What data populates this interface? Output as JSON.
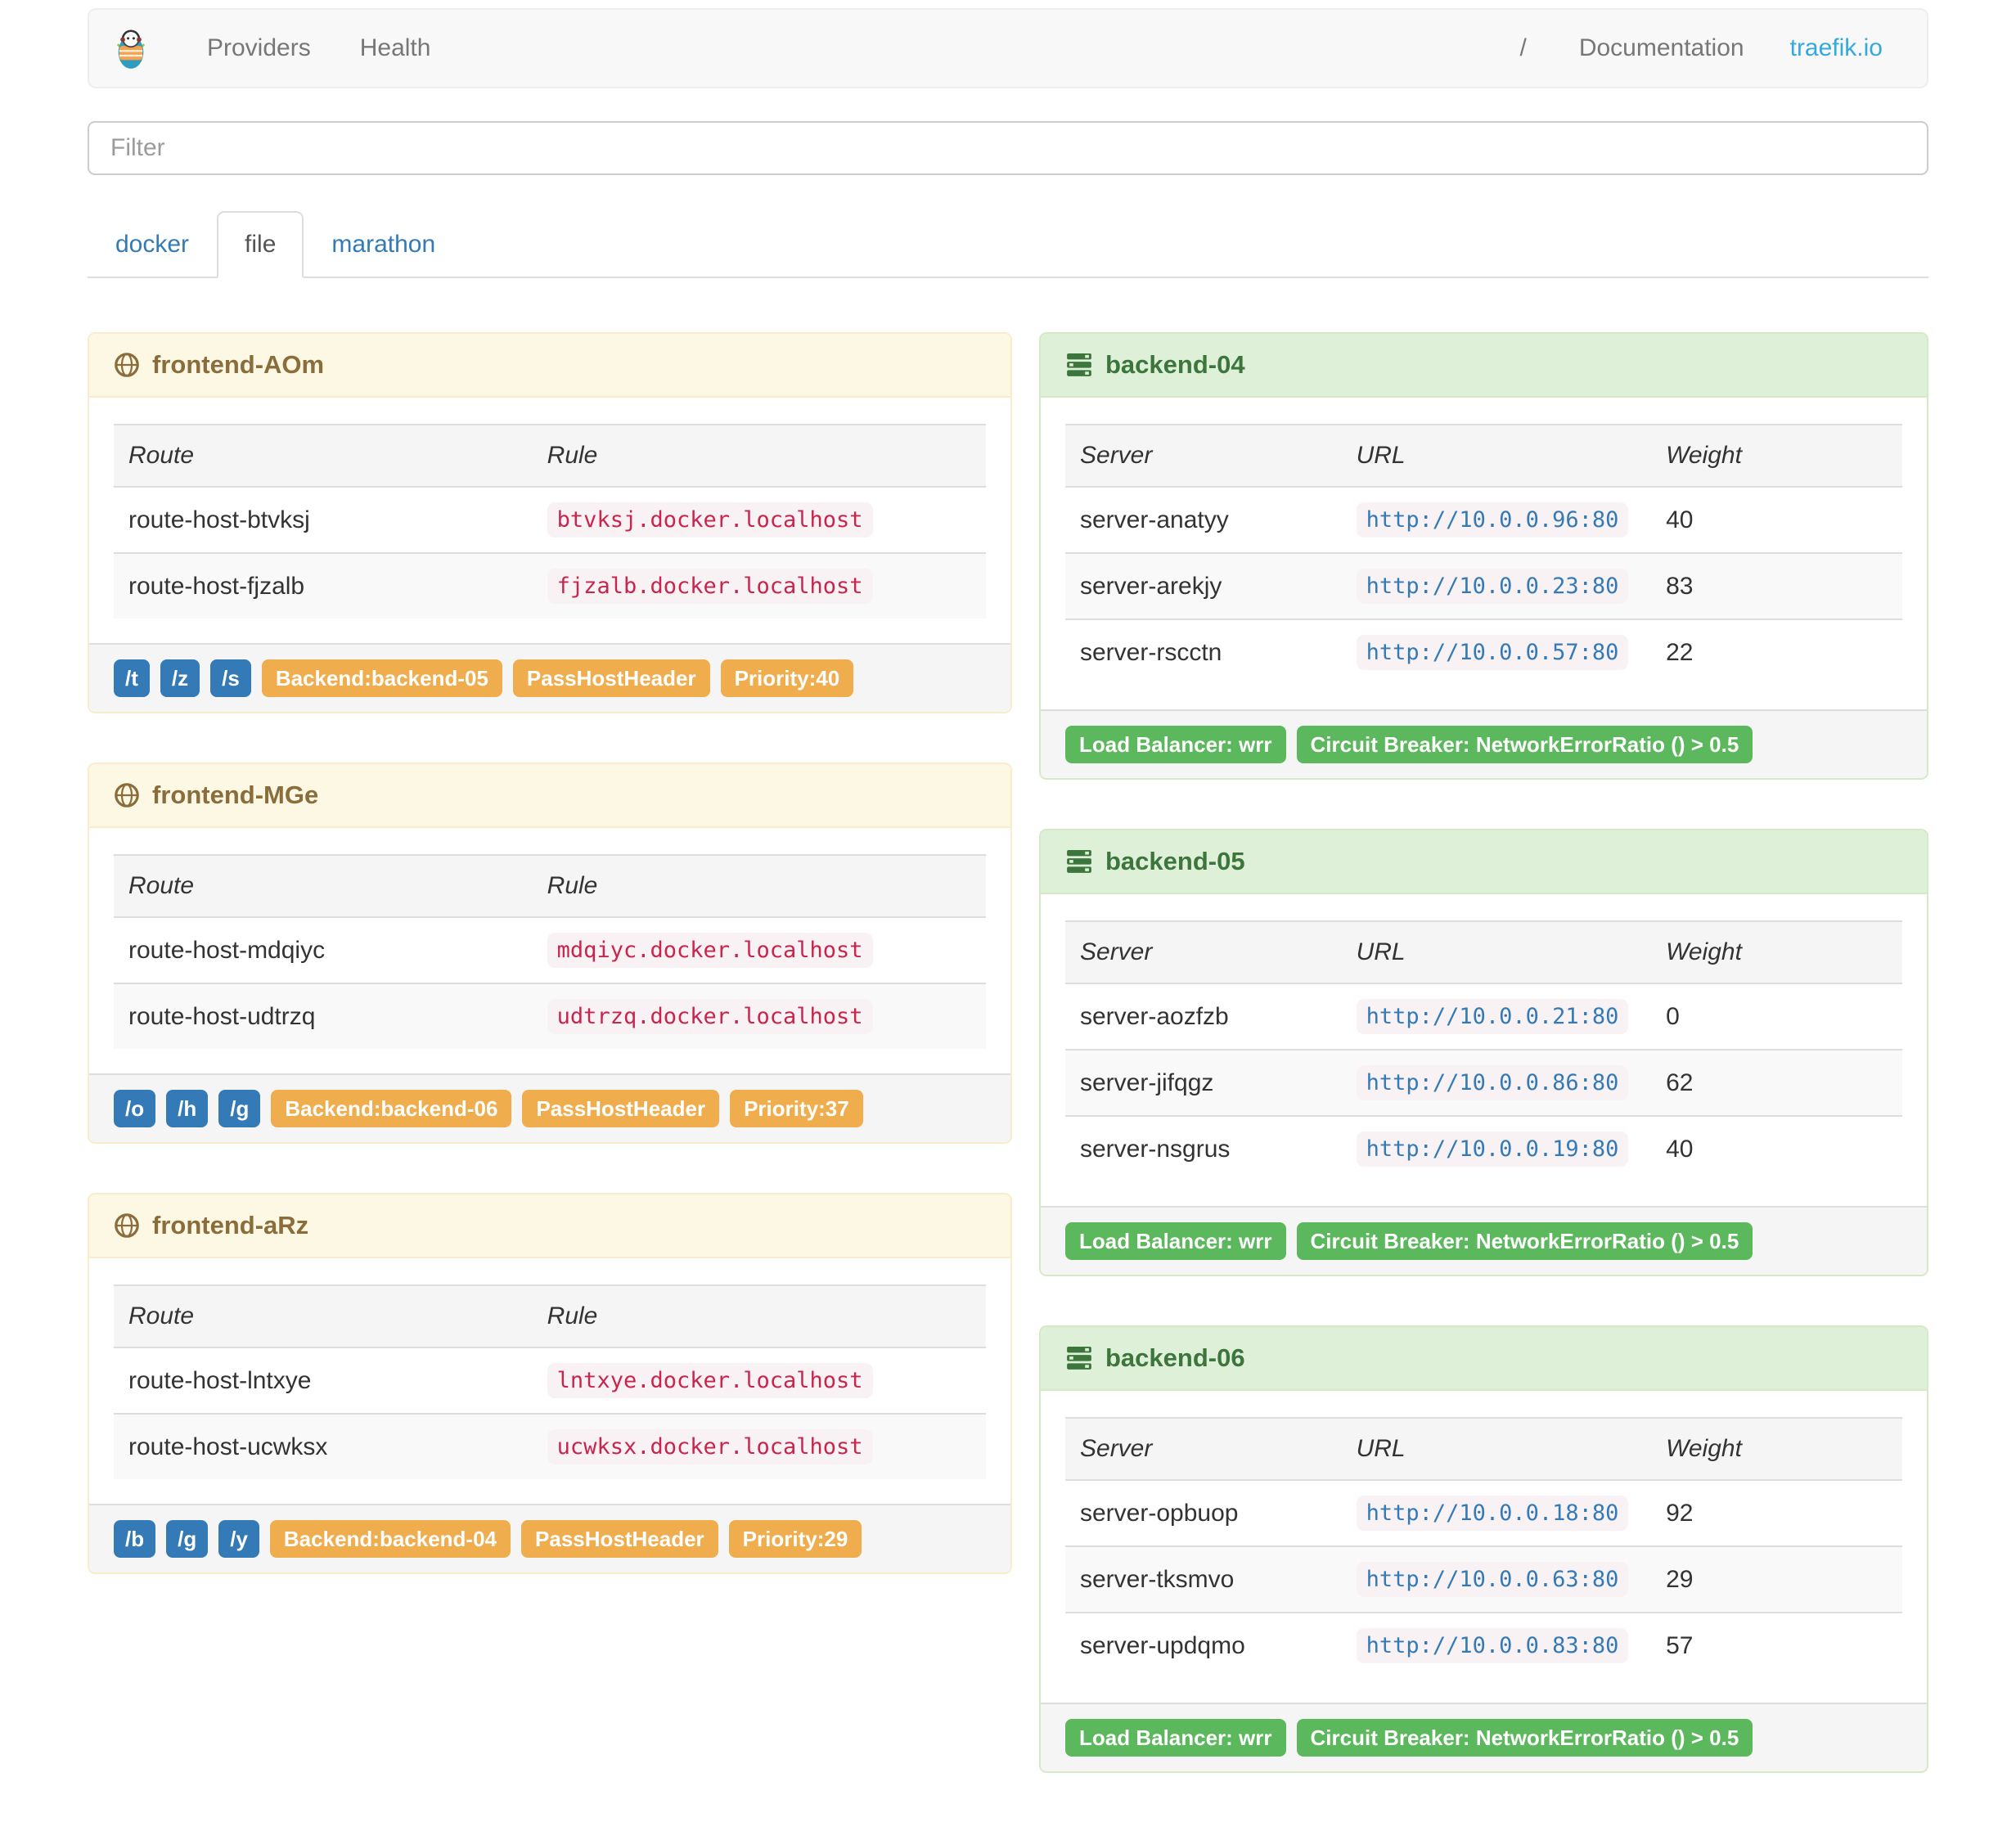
{
  "navbar": {
    "brand_icon": "traefik-logo",
    "links": [
      {
        "label": "Providers"
      },
      {
        "label": "Health"
      }
    ],
    "right": {
      "separator": "/",
      "documentation": "Documentation",
      "site": "traefik.io"
    }
  },
  "filter": {
    "placeholder": "Filter",
    "value": ""
  },
  "tabs": [
    {
      "label": "docker",
      "active": false
    },
    {
      "label": "file",
      "active": true
    },
    {
      "label": "marathon",
      "active": false
    }
  ],
  "frontends": [
    {
      "name": "frontend-AOm",
      "columns": [
        "Route",
        "Rule"
      ],
      "routes": [
        {
          "route": "route-host-btvksj",
          "rule": "btvksj.docker.localhost"
        },
        {
          "route": "route-host-fjzalb",
          "rule": "fjzalb.docker.localhost"
        }
      ],
      "entrypoints": [
        "/t",
        "/z",
        "/s"
      ],
      "badges": [
        "Backend:backend-05",
        "PassHostHeader",
        "Priority:40"
      ]
    },
    {
      "name": "frontend-MGe",
      "columns": [
        "Route",
        "Rule"
      ],
      "routes": [
        {
          "route": "route-host-mdqiyc",
          "rule": "mdqiyc.docker.localhost"
        },
        {
          "route": "route-host-udtrzq",
          "rule": "udtrzq.docker.localhost"
        }
      ],
      "entrypoints": [
        "/o",
        "/h",
        "/g"
      ],
      "badges": [
        "Backend:backend-06",
        "PassHostHeader",
        "Priority:37"
      ]
    },
    {
      "name": "frontend-aRz",
      "columns": [
        "Route",
        "Rule"
      ],
      "routes": [
        {
          "route": "route-host-lntxye",
          "rule": "lntxye.docker.localhost"
        },
        {
          "route": "route-host-ucwksx",
          "rule": "ucwksx.docker.localhost"
        }
      ],
      "entrypoints": [
        "/b",
        "/g",
        "/y"
      ],
      "badges": [
        "Backend:backend-04",
        "PassHostHeader",
        "Priority:29"
      ]
    }
  ],
  "backends": [
    {
      "name": "backend-04",
      "columns": [
        "Server",
        "URL",
        "Weight"
      ],
      "servers": [
        {
          "server": "server-anatyy",
          "url": "http://10.0.0.96:80",
          "weight": "40"
        },
        {
          "server": "server-arekjy",
          "url": "http://10.0.0.23:80",
          "weight": "83"
        },
        {
          "server": "server-rscctn",
          "url": "http://10.0.0.57:80",
          "weight": "22"
        }
      ],
      "footer": [
        "Load Balancer: wrr",
        "Circuit Breaker: NetworkErrorRatio () > 0.5"
      ]
    },
    {
      "name": "backend-05",
      "columns": [
        "Server",
        "URL",
        "Weight"
      ],
      "servers": [
        {
          "server": "server-aozfzb",
          "url": "http://10.0.0.21:80",
          "weight": "0"
        },
        {
          "server": "server-jifqgz",
          "url": "http://10.0.0.86:80",
          "weight": "62"
        },
        {
          "server": "server-nsgrus",
          "url": "http://10.0.0.19:80",
          "weight": "40"
        }
      ],
      "footer": [
        "Load Balancer: wrr",
        "Circuit Breaker: NetworkErrorRatio () > 0.5"
      ]
    },
    {
      "name": "backend-06",
      "columns": [
        "Server",
        "URL",
        "Weight"
      ],
      "servers": [
        {
          "server": "server-opbuop",
          "url": "http://10.0.0.18:80",
          "weight": "92"
        },
        {
          "server": "server-tksmvo",
          "url": "http://10.0.0.63:80",
          "weight": "29"
        },
        {
          "server": "server-updqmo",
          "url": "http://10.0.0.83:80",
          "weight": "57"
        }
      ],
      "footer": [
        "Load Balancer: wrr",
        "Circuit Breaker: NetworkErrorRatio () > 0.5"
      ]
    }
  ],
  "colors": {
    "frontend_header_bg": "#fcf8e3",
    "frontend_border": "#faebcc",
    "frontend_text": "#8a6d3b",
    "backend_header_bg": "#dff0d8",
    "backend_border": "#d6e9c6",
    "backend_text": "#3c763d",
    "label_primary": "#337ab7",
    "label_warning": "#f0ad4e",
    "label_success": "#5cb85c",
    "code_bg": "#f9f2f4",
    "code_text": "#c7254e",
    "link_blue": "#337ab7",
    "brand_blue": "#34aadc"
  }
}
